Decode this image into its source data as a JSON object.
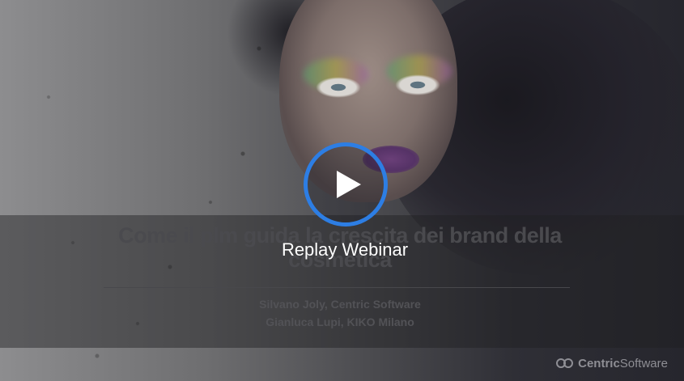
{
  "video": {
    "overlay_label": "Replay Webinar",
    "play_icon": "play-icon"
  },
  "slide": {
    "title": "Come il plm guida la crescita dei brand della cosmetica",
    "speakers": [
      "Silvano Joly, Centric Software",
      "Gianluca Lupi, KIKO Milano"
    ],
    "logo": {
      "word1": "Centric",
      "word2": "Software"
    }
  },
  "colors": {
    "play_accent": "#2d7ee4",
    "label": "#ffffff"
  }
}
